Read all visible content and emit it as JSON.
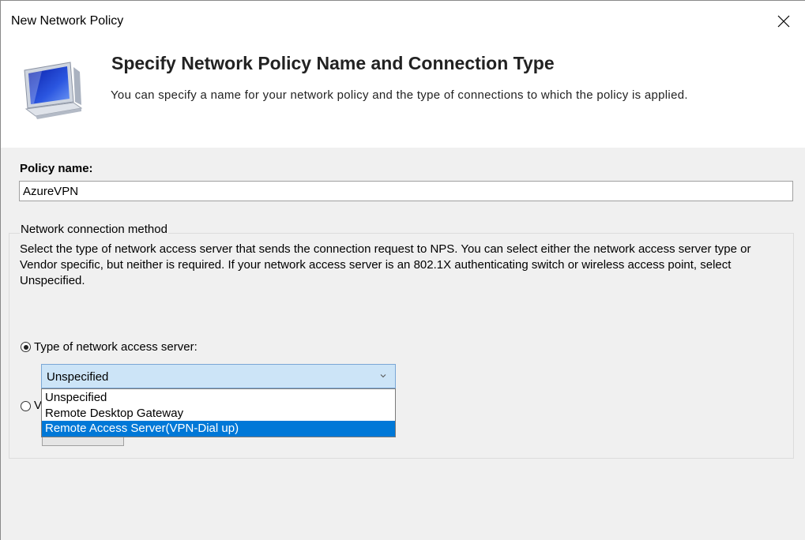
{
  "window": {
    "title": "New Network Policy"
  },
  "banner": {
    "title": "Specify Network Policy Name and Connection Type",
    "subtitle": "You can specify a name for your network policy and the type of connections to which the policy is applied."
  },
  "policy": {
    "label": "Policy name:",
    "value": "AzureVPN"
  },
  "connection_method": {
    "title": "Network connection method",
    "description": "Select the type of network access server that sends the connection request to NPS. You can select either the network access server type or Vendor specific, but neither is required.  If your network access server is an 802.1X authenticating switch or wireless access point, select Unspecified.",
    "option_type_label": "Type of network access server:",
    "option_vendor_label_visible": "V",
    "type_selected": "Unspecified",
    "type_options": [
      "Unspecified",
      "Remote Desktop Gateway",
      "Remote Access Server(VPN-Dial up)"
    ],
    "highlighted_option": "Remote Access Server(VPN-Dial up)"
  },
  "colors": {
    "highlight": "#0078d7",
    "combo_focus": "#cce4f7"
  }
}
